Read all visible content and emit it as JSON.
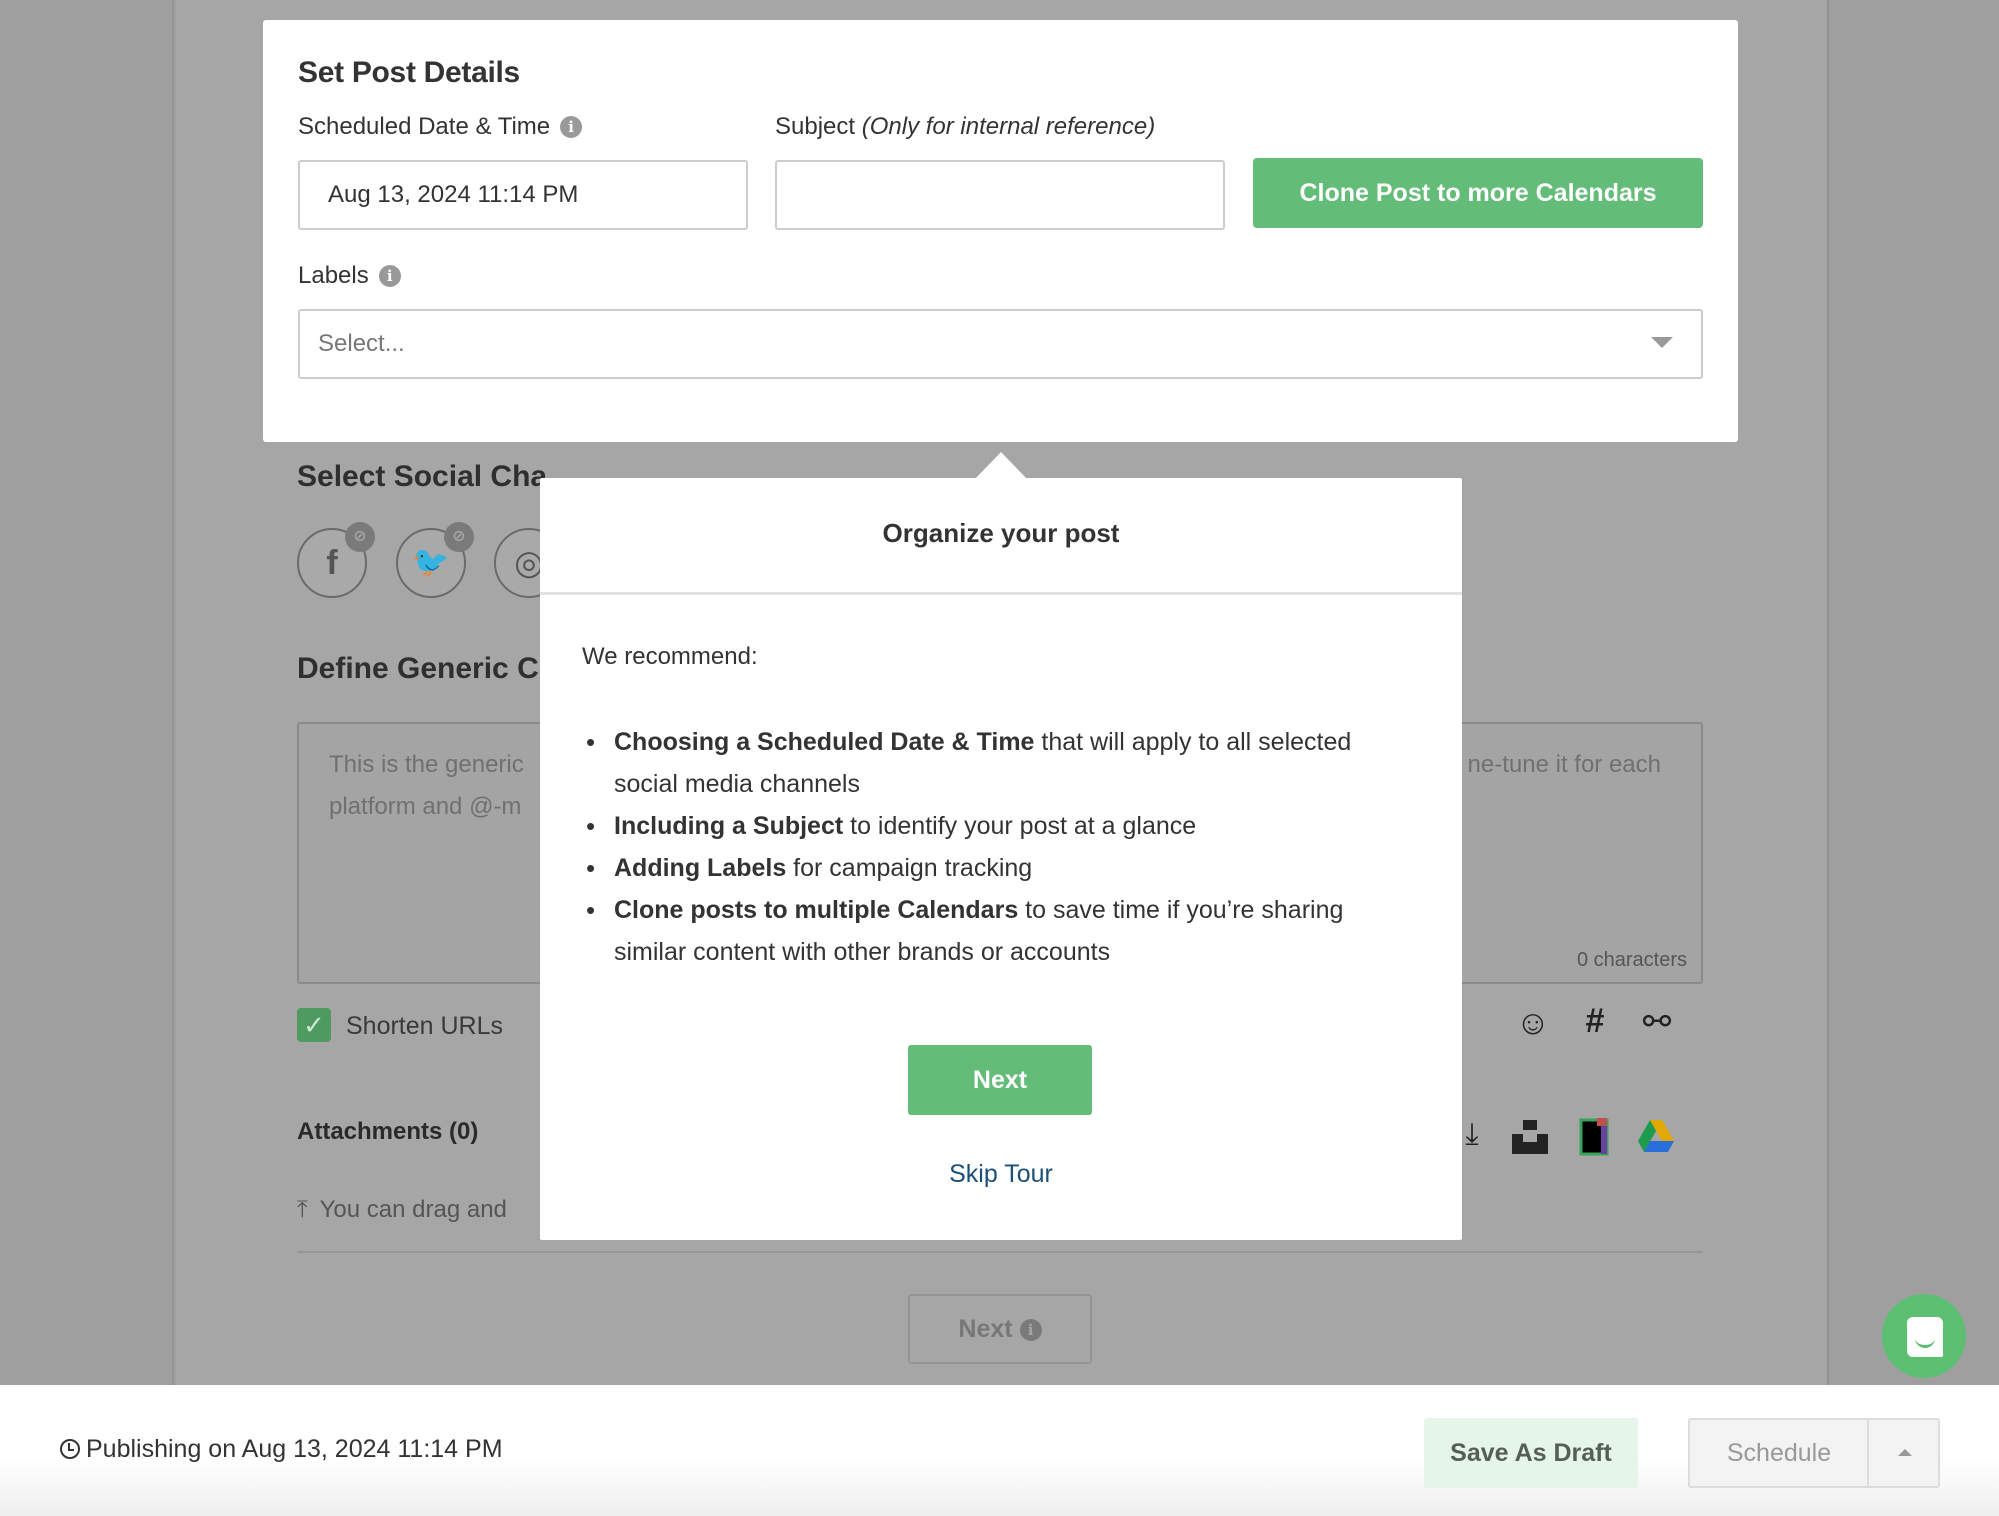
{
  "post_details": {
    "title": "Set Post Details",
    "scheduled_label": "Scheduled Date & Time",
    "scheduled_value": "Aug 13, 2024 11:14 PM",
    "subject_label": "Subject",
    "subject_hint": "(Only for internal reference)",
    "subject_value": "",
    "clone_button": "Clone Post to more Calendars",
    "labels_label": "Labels",
    "labels_placeholder": "Select..."
  },
  "channels": {
    "title": "Select Social Channels",
    "title_visible": "Select Social Cha",
    "items": [
      {
        "name": "facebook",
        "glyph": "f",
        "badge": "unlinked"
      },
      {
        "name": "twitter",
        "glyph": "🐦",
        "badge": "unlinked"
      },
      {
        "name": "instagram",
        "glyph": "◎"
      }
    ]
  },
  "content": {
    "title_visible": "Define Generic C",
    "placeholder_left_1": "This is the generic",
    "placeholder_left_2": "platform and @-m",
    "placeholder_right": "ne-tune it for each",
    "char_count": "0 characters",
    "shorten_urls_label": "Shorten URLs",
    "shorten_urls_checked": true,
    "tools": [
      "emoji-icon",
      "hashtag-icon",
      "link-icon"
    ]
  },
  "attachments": {
    "title": "Attachments (0)",
    "drop_hint_visible": "You can drag and",
    "sources": [
      "download-icon",
      "unsplash-icon",
      "file-icon",
      "google-drive-icon"
    ],
    "next_label": "Next"
  },
  "tour": {
    "title": "Organize your post",
    "intro": "We recommend:",
    "items": [
      {
        "bold": "Choosing a Scheduled Date & Time",
        "rest": " that will apply to all selected social media channels"
      },
      {
        "bold": "Including a Subject",
        "rest": " to identify your post at a glance"
      },
      {
        "bold": "Adding Labels",
        "rest": " for campaign tracking"
      },
      {
        "bold": "Clone posts to multiple Calendars",
        "rest": " to save time if you’re sharing similar content with other brands or accounts"
      }
    ],
    "next_button": "Next",
    "skip_link": "Skip Tour"
  },
  "footer": {
    "publishing_text": "Publishing on Aug 13, 2024 11:14 PM",
    "save_draft": "Save As Draft",
    "schedule": "Schedule"
  },
  "colors": {
    "accent_green": "#63bd78",
    "link_blue": "#1c4f78",
    "overlay_gray": "#a6a6a6"
  }
}
